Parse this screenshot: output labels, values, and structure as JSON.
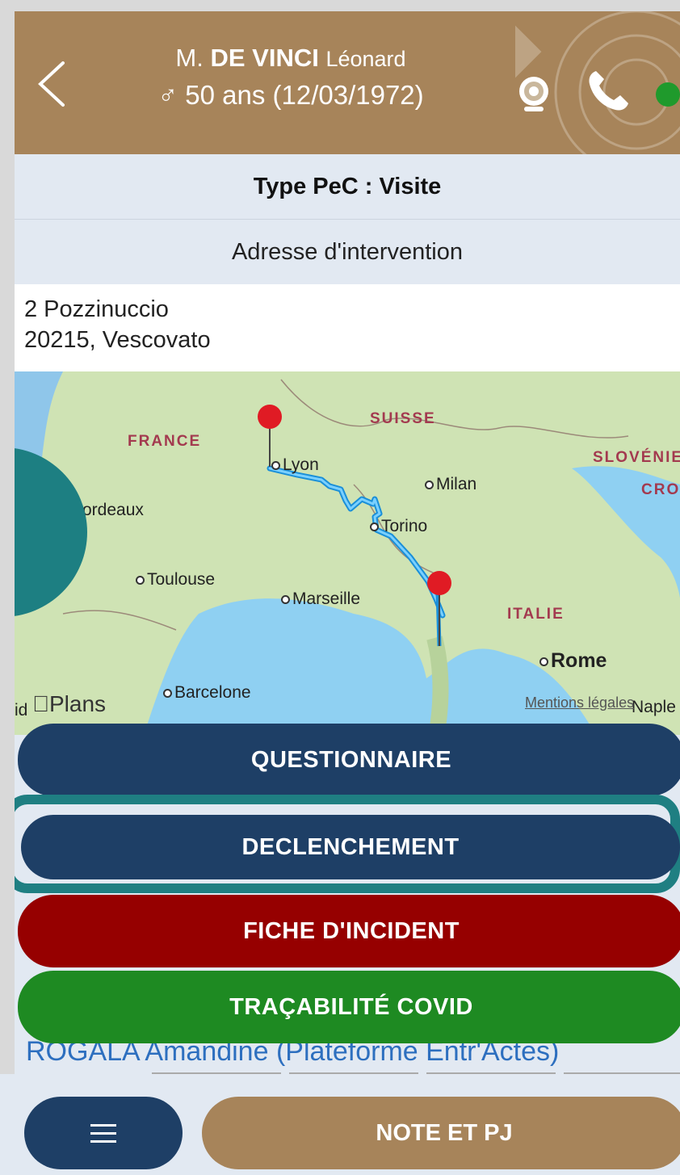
{
  "header": {
    "title_prefix": "M.",
    "last_name": "DE VINCI",
    "first_name": "Léonard",
    "age_line": "♂ 50 ans (12/03/1972)",
    "status_color": "#1f9a2c"
  },
  "type_row": {
    "label": "Type PeC : Visite"
  },
  "address": {
    "title": "Adresse d'intervention",
    "line1": "2 Pozzinuccio",
    "line2": "20215, Vescovato"
  },
  "map": {
    "countries": [
      "FRANCE",
      "SUISSE",
      "SLOVÉNIE",
      "CRO",
      "ITALIE"
    ],
    "cities": [
      "Lyon",
      "Milan",
      "Bordeaux",
      "Torino",
      "Toulouse",
      "Marseille",
      "Rome",
      "Barcelone",
      "Naple",
      "id"
    ],
    "brand": "Plans",
    "legal": "Mentions légales"
  },
  "buttons": {
    "questionnaire": "QUESTIONNAIRE",
    "declenchement": "DECLENCHEMENT",
    "incident": "FICHE D'INCIDENT",
    "covid": "TRAÇABILITÉ COVID"
  },
  "behind_text": "ROGALA Amandine (Plateforme Entr'Actes)",
  "bottom": {
    "note": "NOTE ET PJ"
  },
  "colors": {
    "header": "#a7845a",
    "primary": "#1e3f66",
    "danger": "#960000",
    "success": "#1e8a22",
    "highlight": "#1f7f82"
  }
}
